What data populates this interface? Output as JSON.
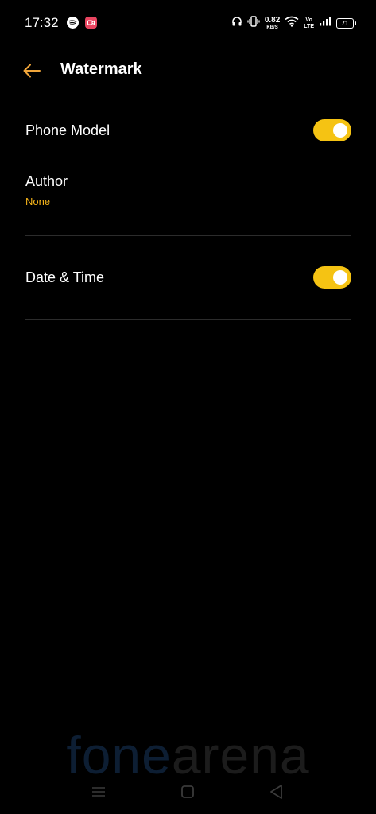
{
  "status_bar": {
    "time": "17:32",
    "net_speed_value": "0.82",
    "net_speed_unit": "KB/S",
    "volte_top": "Vo",
    "volte_bottom": "LTE",
    "battery": "71",
    "icons": [
      "spotify-icon",
      "screen-recorder-icon",
      "headphones-icon",
      "vibrate-icon",
      "wifi-icon",
      "signal-icon",
      "battery-icon"
    ]
  },
  "header": {
    "title": "Watermark",
    "back_icon": "arrow-left-icon"
  },
  "settings": {
    "phone_model": {
      "label": "Phone Model",
      "enabled": true
    },
    "author": {
      "label": "Author",
      "value": "None"
    },
    "date_time": {
      "label": "Date & Time",
      "enabled": true
    }
  },
  "watermark": {
    "part1": "fone",
    "part2": "arena"
  },
  "nav_bar": {
    "icons": [
      "menu-icon",
      "home-icon",
      "back-triangle-icon"
    ]
  },
  "colors": {
    "background": "#000000",
    "accent": "#f5c313",
    "sublabel": "#f5b41a",
    "back_arrow": "#f0a53a",
    "divider": "#2c2c2c"
  }
}
